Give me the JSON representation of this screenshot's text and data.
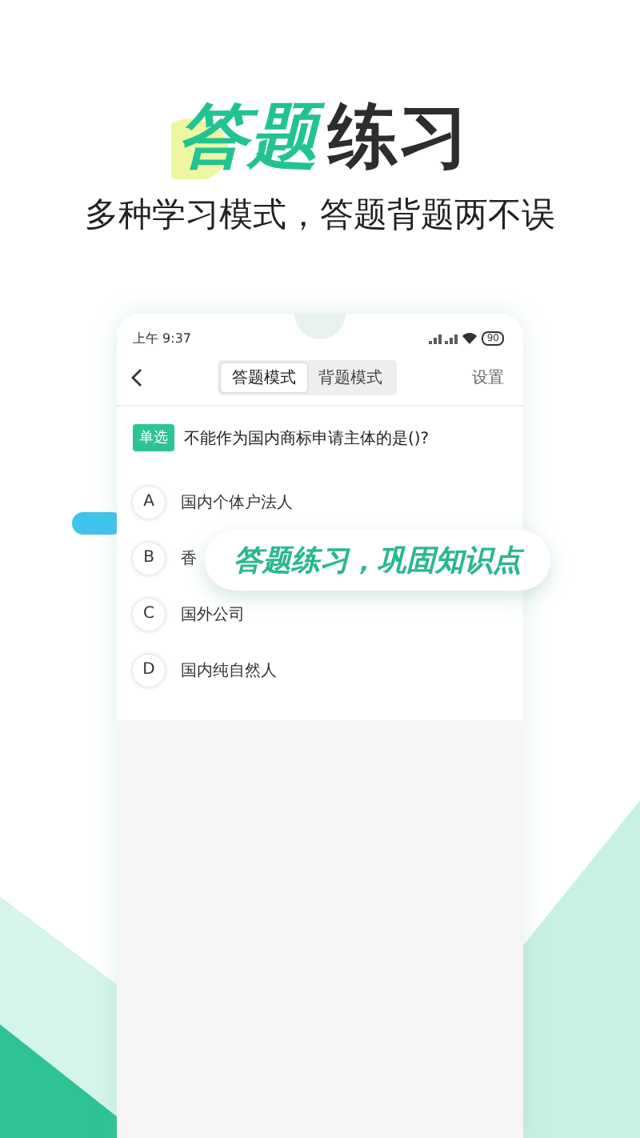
{
  "headline": {
    "accent": "答题",
    "rest": "练习"
  },
  "subtitle": "多种学习模式，答题背题两不误",
  "phone": {
    "status_time": "上午 9:37",
    "battery": "90",
    "tabs": [
      {
        "label": "答题模式",
        "selected": true
      },
      {
        "label": "背题模式",
        "selected": false
      }
    ],
    "settings": "设置",
    "question": {
      "badge": "单选",
      "text": "不能作为国内商标申请主体的是()?"
    },
    "options": [
      {
        "letter": "A",
        "text": "国内个体户法人"
      },
      {
        "letter": "B",
        "text": "香"
      },
      {
        "letter": "C",
        "text": "国外公司"
      },
      {
        "letter": "D",
        "text": "国内纯自然人"
      }
    ]
  },
  "callout": "答题练习，巩固知识点"
}
